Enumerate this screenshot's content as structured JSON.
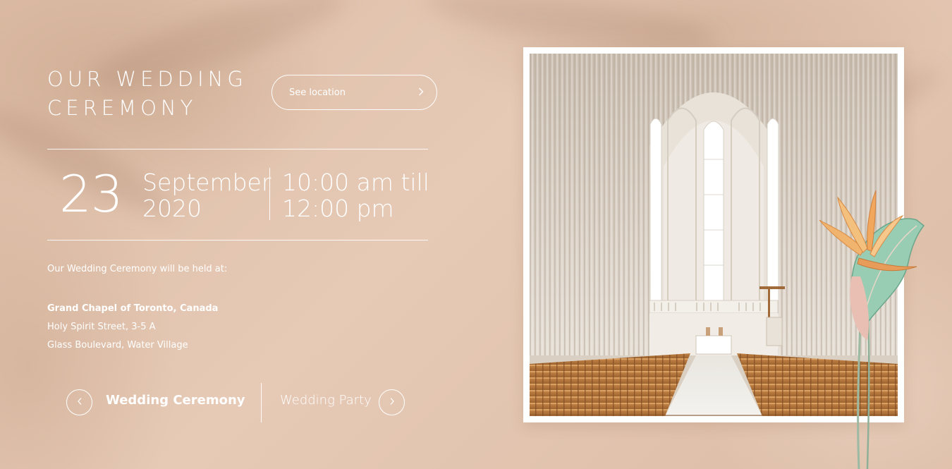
{
  "ceremony": {
    "title_line1": "OUR WEDDING",
    "title_line2": "CEREMONY",
    "see_location_label": "See location",
    "day": "23",
    "month": "September",
    "year": "2020",
    "time_start": "10:00 am till",
    "time_end": "12:00 pm",
    "held_at": "Our Wedding Ceremony will be held at:",
    "venue": "Grand Chapel of Toronto, Canada",
    "address_line1": "Holy Spirit Street, 3-5 A",
    "address_line2": "Glass Boulevard, Water Village"
  },
  "tabs": {
    "active": "Wedding Ceremony",
    "next": "Wedding Party"
  },
  "icons": {
    "see_location": "chevron-right-icon",
    "prev": "chevron-left-icon",
    "next": "chevron-right-icon"
  },
  "colors": {
    "background": "#e3c4ae",
    "text": "#ffffff",
    "frame": "#ffffff"
  }
}
